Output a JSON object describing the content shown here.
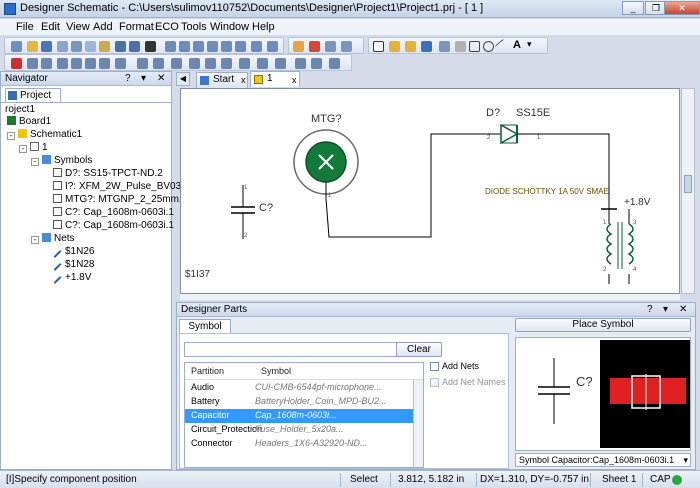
{
  "window": {
    "title": "Designer Schematic - C:\\Users\\sulimov110752\\Documents\\Designer\\Project1\\Project1.prj - [ 1 ]",
    "controls": [
      "_",
      "❐",
      "✕"
    ]
  },
  "menu": [
    "File",
    "Edit",
    "View",
    "Add",
    "Format",
    "ECO",
    "Tools",
    "Window",
    "Help"
  ],
  "navigator": {
    "title": "Navigator",
    "controls": [
      "?",
      "▾",
      "✕"
    ],
    "tab": "Project",
    "tree": [
      {
        "label": "roject1",
        "level": 0
      },
      {
        "label": "Board1",
        "level": 0
      },
      {
        "label": "Schematic1",
        "level": 0
      },
      {
        "label": "1",
        "level": 1
      },
      {
        "label": "Symbols",
        "level": 2
      },
      {
        "label": "D?: SS15-TPCT-ND.2",
        "level": 3
      },
      {
        "label": "I?: XFM_2W_Pulse_BV030.1",
        "level": 3
      },
      {
        "label": "MTG?: MTGNP_2_25mm.1",
        "level": 3
      },
      {
        "label": "C?: Cap_1608m-0603i.1",
        "level": 3
      },
      {
        "label": "C?: Cap_1608m-0603i.1",
        "level": 3
      },
      {
        "label": "Nets",
        "level": 2
      },
      {
        "label": "$1N26",
        "level": 3
      },
      {
        "label": "$1N28",
        "level": 3
      },
      {
        "label": "+1.8V",
        "level": 3
      }
    ]
  },
  "doc_tabs": [
    {
      "label": "Start Page",
      "close": "x"
    },
    {
      "label": "1",
      "close": "x"
    }
  ],
  "schematic": {
    "mtg_label": "MTG?",
    "diode_ref": "D?",
    "diode_value": "SS15E",
    "diode_desc": "DIODE SCHOTTKY 1A 50V SMAE",
    "cap_label": "C?",
    "power_label": "+1.8V",
    "sheet_id": "$1I37",
    "pin1": "1",
    "pin2": "2",
    "pin_cap1": "1",
    "pin_cap2": "2",
    "pin_d1": "1",
    "pin_d2": "2",
    "pin_mtg": "1",
    "pin_x1": "1",
    "pin_x2": "2",
    "pin_x3": "3",
    "pin_x4": "4"
  },
  "parts": {
    "title": "Designer Parts",
    "controls": [
      "?",
      "▾",
      "✕"
    ],
    "tab": "Symbol View",
    "search_value": "",
    "clear_label": "Clear",
    "add_nets_label": "Add Nets",
    "add_net_names_label": "Add Net Names",
    "add_nets_checked": false,
    "add_net_names_checked": false,
    "place_symbol_label": "Place Symbol",
    "columns": [
      "Partition",
      "Symbol"
    ],
    "rows": [
      {
        "partition": "Audio",
        "symbol": "CUI-CMB-6544pf-microphone...",
        "selected": false
      },
      {
        "partition": "Battery",
        "symbol": "BatteryHolder_Coin_MPD-BU2...",
        "selected": false
      },
      {
        "partition": "Capacitor",
        "symbol": "Cap_1608m-0603i...",
        "selected": true
      },
      {
        "partition": "Circuit_Protection",
        "symbol": "Fuse_Holder_5x20a...",
        "selected": false
      },
      {
        "partition": "Connector",
        "symbol": "Headers_1X6-A32920-ND...",
        "selected": false
      }
    ],
    "preview_label": "C?",
    "symbol_select": "Symbol Capacitor:Cap_1608m-0603i.1"
  },
  "status": {
    "message": "[I]Specify component position",
    "mode": "Select",
    "coords": "3.812, 5.182 in",
    "delta": "DX=1.310, DY=-0.757 in",
    "sheet": "Sheet 1",
    "cap": "CAP"
  }
}
